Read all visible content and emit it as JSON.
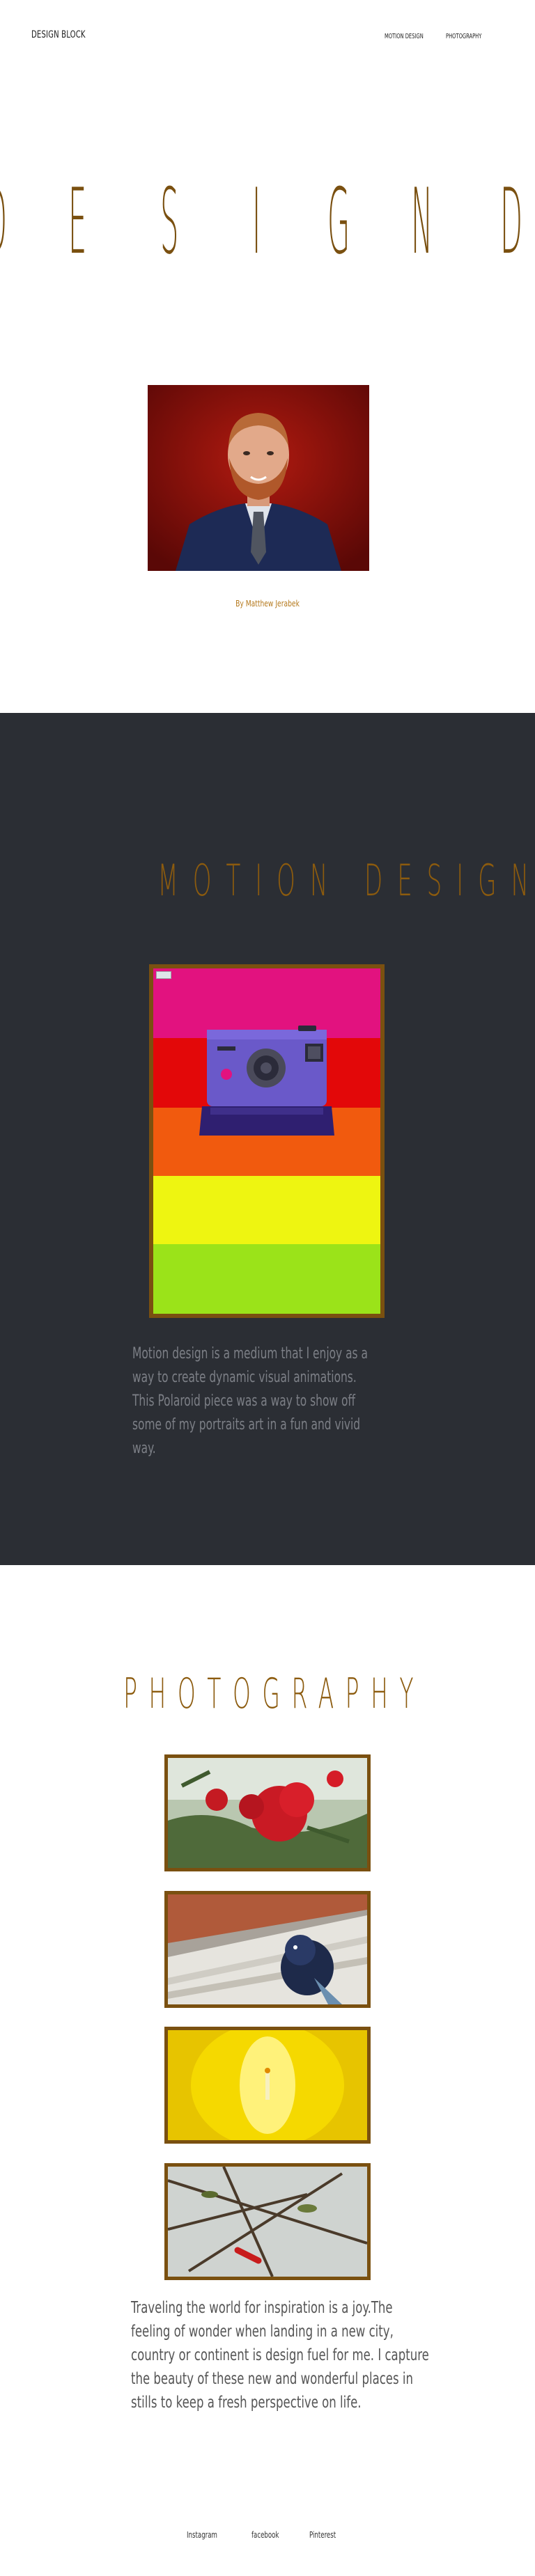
{
  "header": {
    "brand": "DESIGN BLOCK",
    "nav": [
      {
        "label": "MOTION DESIGN"
      },
      {
        "label": "PHOTOGRAPHY"
      }
    ]
  },
  "hero": {
    "letters": [
      "D",
      "E",
      "S",
      "I",
      "G",
      "N",
      "D"
    ],
    "byline": "By Matthew Jerabek"
  },
  "motion": {
    "title": "MOTION DESIGN",
    "text": [
      "Motion design is a medium that I enjoy  as a",
      "way to create  dynamic visual animations.",
      "This Polaroid piece was a way to show off",
      "some of my portraits art in a fun and vivid",
      "way."
    ],
    "stripe_colors": [
      "#e2127f",
      "#e30809",
      "#f15a0e",
      "#eef511",
      "#9be319"
    ]
  },
  "photography": {
    "title": "PHOTOGRAPHY",
    "text": [
      "Traveling the world for inspiration is a joy.The",
      "feeling of wonder when landing in a new city,",
      "country or continent is design fuel for me. I capture",
      "the beauty of these new and wonderful places in",
      "stills to keep a fresh perspective on life."
    ]
  },
  "footer": {
    "links": [
      {
        "label": "Instagram"
      },
      {
        "label": "facebook"
      },
      {
        "label": "Pinterest"
      }
    ]
  },
  "colors": {
    "accent": "#7a5010",
    "dark_section": "#2b2e34"
  }
}
